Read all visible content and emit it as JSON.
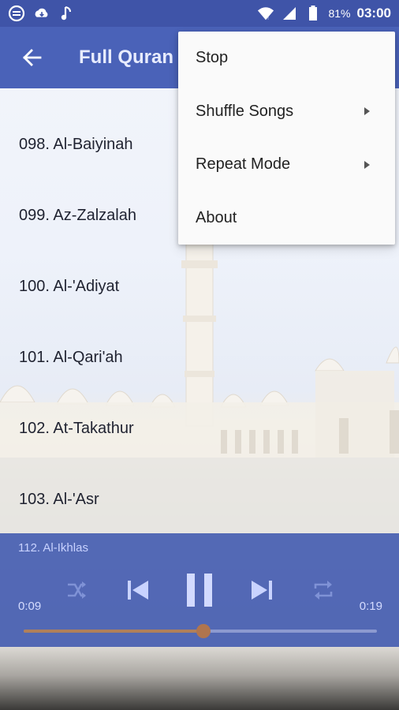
{
  "status_bar": {
    "battery": "81%",
    "time": "03:00",
    "icons": [
      "sync-icon",
      "cloud-download-icon",
      "music-note-icon",
      "wifi-icon",
      "signal-icon",
      "battery-icon"
    ]
  },
  "app_bar": {
    "title": "Full Quran"
  },
  "list": {
    "items": [
      "098. Al-Baiyinah",
      "099. Az-Zalzalah",
      "100. Al-'Adiyat",
      "101. Al-Qari'ah",
      "102. At-Takathur",
      "103. Al-'Asr"
    ]
  },
  "player": {
    "now_playing": "112. Al-Ikhlas",
    "elapsed": "0:09",
    "total": "0:19",
    "progress": 0.51
  },
  "menu": {
    "items": [
      {
        "label": "Stop",
        "has_submenu": false
      },
      {
        "label": "Shuffle Songs",
        "has_submenu": true
      },
      {
        "label": "Repeat Mode",
        "has_submenu": true
      },
      {
        "label": "About",
        "has_submenu": false
      }
    ]
  },
  "colors": {
    "status_bar": "#3f54a8",
    "app_bar": "#4a62b8",
    "player": "#465eb2",
    "seek_thumb": "#b0754e"
  }
}
